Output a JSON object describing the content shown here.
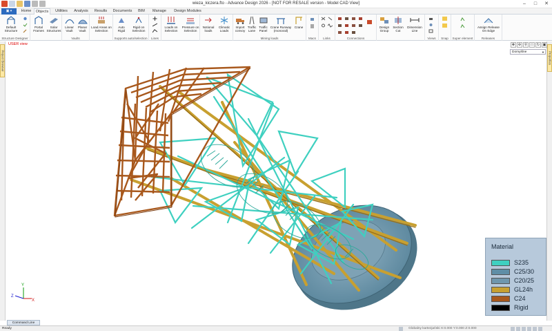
{
  "window": {
    "title": "wieza_kiczera.fto - Advance Design 2026 - [NOT FOR RESALE version - Model CAD View]"
  },
  "app_button_label": "▣ ▾",
  "tabs": [
    {
      "label": "Home",
      "active": false
    },
    {
      "label": "Objects",
      "active": true
    },
    {
      "label": "Utilities",
      "active": false
    },
    {
      "label": "Analysis",
      "active": false
    },
    {
      "label": "Results",
      "active": false
    },
    {
      "label": "Documents",
      "active": false
    },
    {
      "label": "BIM",
      "active": false
    },
    {
      "label": "Manage",
      "active": false
    },
    {
      "label": "Design Modules",
      "active": false
    }
  ],
  "ribbon": {
    "groups": [
      {
        "caption": "Structure Designer"
      },
      {
        "caption": ""
      },
      {
        "caption": "Vaults"
      },
      {
        "caption": ""
      },
      {
        "caption": "Supports auto/selection"
      },
      {
        "caption": "Lines"
      },
      {
        "caption": ""
      },
      {
        "caption": ""
      },
      {
        "caption": "Mining loads"
      },
      {
        "caption": "Macs"
      },
      {
        "caption": "Links"
      },
      {
        "caption": "Connections"
      },
      {
        "caption": ""
      },
      {
        "caption": "Views"
      },
      {
        "caption": "Snap"
      },
      {
        "caption": "Super element"
      },
      {
        "caption": "Releases"
      }
    ],
    "buttons": {
      "default_structure": "Default Structure",
      "portal_frames": "Portal Frames",
      "solar_structures": "Solar Structures",
      "linear_vault": "Linear Vault",
      "planar_vault": "Planar Vault",
      "load_areas": "Load Areas on Selection",
      "auto_rigid": "Auto Rigid",
      "rigid_on_selection": "Rigid on Selection",
      "loads_on_selection": "Loads on Selection",
      "pressure_on_selection": "Pressure on Selection",
      "notional_loads": "Notional loads",
      "climatic_loads": "Climatic Loads",
      "import_convoy": "Import convoy",
      "traffic_lane": "Traffic Lane",
      "traffic_panel": "Traffic Panel",
      "crane_runway": "Crane Runway (monorail)",
      "crane": "Crane",
      "design_group": "Design Group",
      "section_cut": "Section Cut",
      "dimension_line": "Dimension Line",
      "assign_release": "Assign Release On Edge"
    }
  },
  "viewport": {
    "label": "USER view",
    "dropdown_value": "Domyślne"
  },
  "side_tabs": {
    "left": "Project Browser",
    "right": "Properties"
  },
  "legend": {
    "title": "Material",
    "items": [
      {
        "label": "S235",
        "color": "#3fd0c0"
      },
      {
        "label": "C25/30",
        "color": "#5f8ea6"
      },
      {
        "label": "C20/25",
        "color": "#6f97ad"
      },
      {
        "label": "GL24h",
        "color": "#c8a030"
      },
      {
        "label": "C24",
        "color": "#a8581c"
      },
      {
        "label": "Rigid",
        "color": "#000000"
      }
    ]
  },
  "command_tab": "Command Line",
  "status": {
    "ready": "Ready",
    "coords": "Globalny kartezjański   X:0.000  Y:0.000  Z:0.000"
  },
  "colors": {
    "steel": "#3fd0c0",
    "timber_light": "#c8a030",
    "timber_dark": "#a8581c",
    "concrete": "#7fa3b7",
    "accent": "#2c6bbf"
  }
}
